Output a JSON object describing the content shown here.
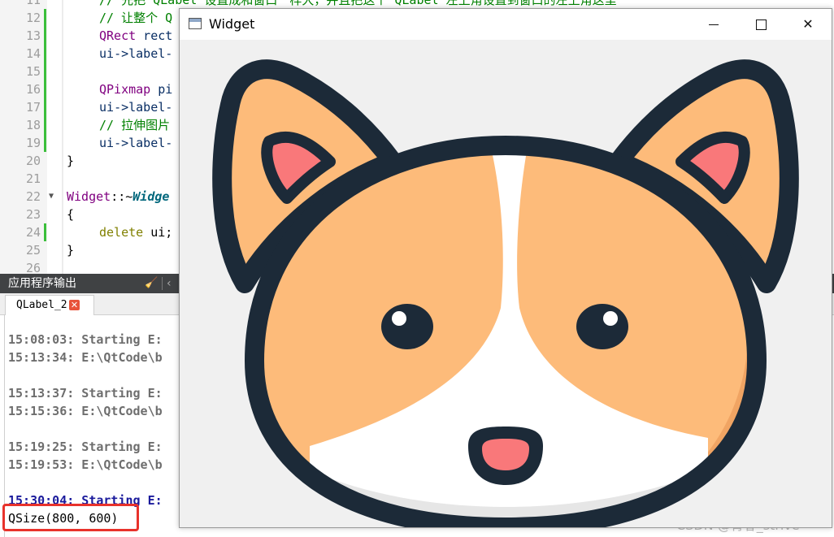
{
  "editor": {
    "lines": [
      {
        "num": "11",
        "parts": [
          {
            "t": "// 先把 QLabel 设置成和窗口一样大，并且把这个 QLabel 左上角设置到窗口的左上角这里",
            "c": "comment"
          }
        ]
      },
      {
        "num": "12",
        "parts": [
          {
            "t": "// 让整个 Q",
            "c": "comment"
          }
        ]
      },
      {
        "num": "13",
        "parts": [
          {
            "t": "QRect",
            "c": "type"
          },
          {
            "t": " rect",
            "c": "id"
          }
        ]
      },
      {
        "num": "14",
        "parts": [
          {
            "t": "ui",
            "c": "id"
          },
          {
            "t": "->label-",
            "c": "id"
          }
        ]
      },
      {
        "num": "15",
        "parts": []
      },
      {
        "num": "16",
        "parts": [
          {
            "t": "QPixmap",
            "c": "type"
          },
          {
            "t": " pi",
            "c": "id"
          }
        ]
      },
      {
        "num": "17",
        "parts": [
          {
            "t": "ui",
            "c": "id"
          },
          {
            "t": "->label-",
            "c": "id"
          }
        ]
      },
      {
        "num": "18",
        "parts": [
          {
            "t": "// 拉伸图片",
            "c": "comment"
          }
        ]
      },
      {
        "num": "19",
        "parts": [
          {
            "t": "ui",
            "c": "id"
          },
          {
            "t": "->label-",
            "c": "id"
          }
        ]
      },
      {
        "num": "20",
        "parts": [
          {
            "t": "}",
            "c": "plain"
          }
        ]
      },
      {
        "num": "21",
        "parts": []
      },
      {
        "num": "22",
        "parts": [
          {
            "t": "Widget",
            "c": "type"
          },
          {
            "t": "::~",
            "c": "plain"
          },
          {
            "t": "Widge",
            "c": "fn"
          }
        ]
      },
      {
        "num": "23",
        "parts": [
          {
            "t": "{",
            "c": "plain"
          }
        ]
      },
      {
        "num": "24",
        "parts": [
          {
            "t": "delete",
            "c": "kw"
          },
          {
            "t": " ui;",
            "c": "plain"
          }
        ]
      },
      {
        "num": "25",
        "parts": [
          {
            "t": "}",
            "c": "plain"
          }
        ]
      },
      {
        "num": "26",
        "parts": []
      }
    ]
  },
  "output": {
    "title": "应用程序输出",
    "tab_label": "QLabel_2",
    "lines": [
      "15:08:03: Starting E:",
      "15:13:34: E:\\QtCode\\b",
      "15:13:37: Starting E:",
      "15:15:36: E:\\QtCode\\b",
      "15:19:25: Starting E:",
      "15:19:53: E:\\QtCode\\b",
      "15:30:04: Starting E:"
    ],
    "result_line": "QSize(800, 600)",
    "watermark": "CSDN @青春_strive"
  },
  "widget_window": {
    "title": "Widget",
    "close_glyph": "✕"
  },
  "colors": {
    "corgi_orange": "#fdbb7a",
    "corgi_outline": "#1c2a38",
    "ear_pink": "#f9787a",
    "highlight_red": "#e8322b"
  }
}
